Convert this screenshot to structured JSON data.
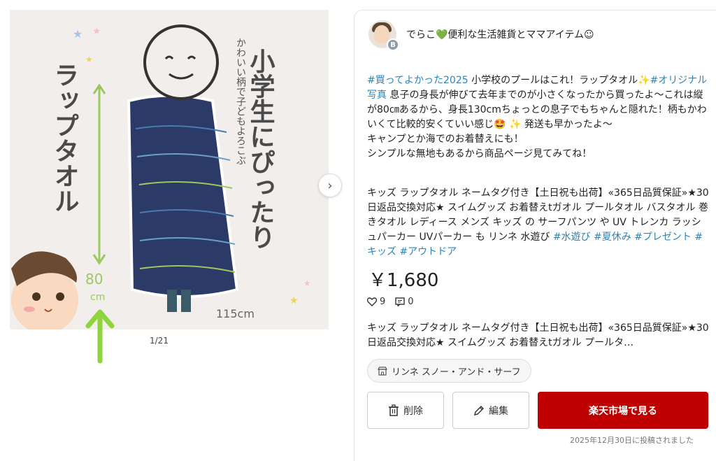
{
  "gallery": {
    "counter": "1/21",
    "next_button": "›",
    "image_text": {
      "main_vertical": "小学生にぴったり",
      "sub_vertical": "かわいい柄で子どもよろこぶ",
      "left_vertical": "ラップタオル",
      "height_label_1": "80",
      "height_label_2": "cm",
      "child_height": "115cm"
    }
  },
  "user": {
    "name": "でらこ💚便利な生活雑貨とママアイテム☺",
    "badge": "B"
  },
  "post": {
    "tag1": "#買ってよかった2025",
    "text1": " 小学校のプールはこれ！ラップタオル✨",
    "tag2": "#オリジナル写真",
    "text2": " 息子の身長が伸びて去年までのが小さくなったから買ったよ～これは縦が80㎝あるから、身長130cmちょっとの息子でもちゃんと隠れた！柄もかわいくて比較的安くていい感じ🤩 ✨ 発送も早かったよ～",
    "line2": "キャンプとか海でのお着替えにも！",
    "line3": "シンプルな無地もあるから商品ページ見てみてね！"
  },
  "product": {
    "title": "キッズ ラップタオル ネームタグ付き【土日祝も出荷】«365日品質保証»★30日返品交換対応★ スイムグッズ お着替えtガオル プールタオル バスタオル 巻きタオル レディース メンズ キッズ の サーフパンツ や UV トレンカ ラッシュパーカー UVパーカー も リンネ 水遊び",
    "tags": "#水遊び #夏休み #プレゼント #キッズ #アウトドア",
    "price": "￥1,680",
    "likes": "9",
    "comments": "0",
    "desc": "キッズ ラップタオル ネームタグ付き【土日祝も出荷】«365日品質保証»★30日返品交換対応★ スイムグッズ お着替えtガオル プールタ…",
    "shop": "リンネ スノー・アンド・サーフ"
  },
  "actions": {
    "delete": "削除",
    "edit": "編集",
    "rakuten": "楽天市場で見る"
  },
  "posted_date": "2025年12月30日に投稿されました",
  "colors": {
    "accent_red": "#bf0000",
    "tag_blue": "#2a84b8",
    "arrow_green": "#8fd43c"
  }
}
